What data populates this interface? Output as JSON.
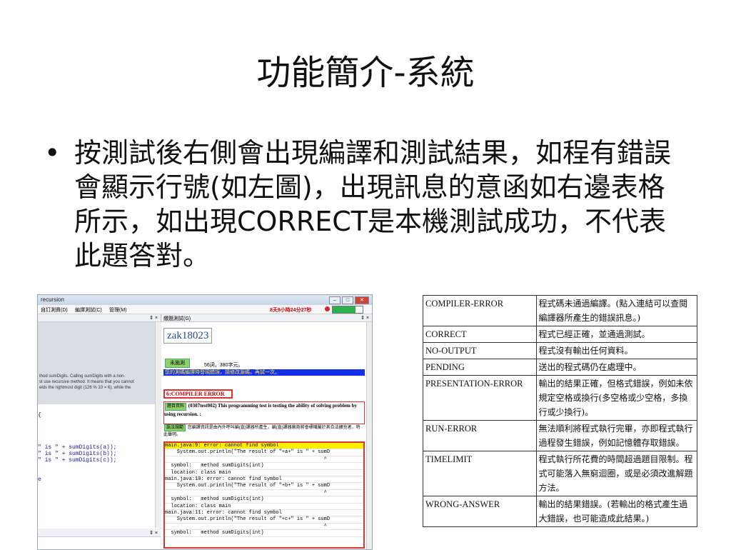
{
  "slide": {
    "title": "功能簡介-系統",
    "bullet_mark": "•",
    "bullet": "按測試後右側會出現編譯和測試結果，如程有錯誤會顯示行號(如左圖)，出現訊息的意函如右邊表格所示，如出現CORRECT是本機測試成功，不代表此題答對。"
  },
  "screenshot": {
    "window_title": "recursion",
    "menu": [
      "自訂測資(D)",
      "編譯測試(C)",
      "管理(M)"
    ],
    "timer": "8天9小時24分27秒",
    "progress": 0.75,
    "left_pane_close": "⇕ ×",
    "right_pane_header": "繳題測試(G)",
    "right_pane_close": "⇕ ×",
    "left_pane2_close": "⇕ ×",
    "desc_text": "thod sumDigits. Calling sumDigits with a non-\nst use recursive method. It means that you cannot\nelds the rightmost digit (126 % 10 = 6), while the",
    "code_lines": [
      "",
      "{",
      "",
      "",
      "",
      "",
      "\" is \" + sumDigits(a));",
      "\" is \" + sumDigits(b));",
      "\" is \" + sumDigits(c));",
      "",
      "",
      "e"
    ],
    "user_id": "zak18023",
    "untested_label": "未施測",
    "stats": "56詞，380字元。",
    "error_banner": "您的測碼編譯時發現錯誤，請修改源碼，再試一次。",
    "compile_error": "6:COMPILER ERROR",
    "problem_tag": "題目資料",
    "problem_text": "(0307test002) This programming test is testing the ability of solving problem by using recursion. :",
    "method_tag": "語法規範",
    "method_text": "您編譯資訊是由內外呼叫編(直)譯器所產生，編(直)譯器廠商將會標幟屬於其合法擴充者，特此聲明。",
    "error_log": [
      {
        "text": "main.java:9: error: cannot find symbol",
        "hl": true
      },
      {
        "text": "    System.out.println(\"The result of \"+a+\" is \" + sumD",
        "hl": false
      },
      {
        "text": "                                                     ^",
        "hl": false
      },
      {
        "text": "  symbol:   method sumDigits(int)",
        "hl": false
      },
      {
        "text": "  location: class main",
        "hl": false
      },
      {
        "text": "main.java:10: error: cannot find symbol",
        "hl": false
      },
      {
        "text": "    System.out.println(\"The result of \"+b+\" is \" + sumD",
        "hl": false
      },
      {
        "text": "                                                     ^",
        "hl": false
      },
      {
        "text": "  symbol:   method sumDigits(int)",
        "hl": false
      },
      {
        "text": "  location: class main",
        "hl": false
      },
      {
        "text": "main.java:11: error: cannot find symbol",
        "hl": false
      },
      {
        "text": "    System.out.println(\"The result of \"+c+\" is \" + sumD",
        "hl": false
      },
      {
        "text": "                                                     ^",
        "hl": false
      },
      {
        "text": "  symbol:   method sumDigits(int)",
        "hl": false
      }
    ]
  },
  "table": [
    {
      "code": "COMPILER-ERROR",
      "desc": "程式碼未通過編譯。(點入連結可以查閱編譯器所產生的錯誤訊息。)"
    },
    {
      "code": "CORRECT",
      "desc": "程式已經正確，並通過測試。"
    },
    {
      "code": "NO-OUTPUT",
      "desc": "程式沒有輸出任何資料。"
    },
    {
      "code": "PENDING",
      "desc": "送出的程式碼仍在處理中。"
    },
    {
      "code": "PRESENTATION-ERROR",
      "desc": "輸出的結果正確，但格式錯誤，例如未依規定空格或換行(多空格或少空格，多換行或少換行)。"
    },
    {
      "code": "RUN-ERROR",
      "desc": "無法順利將程式執行完畢，亦即程式執行過程發生錯誤，例如記憶體存取錯誤。"
    },
    {
      "code": "TIMELIMIT",
      "desc": "程式執行所花費的時間超過題目限制。程式可能落入無窮迴圈，或是必須改進解題方法。"
    },
    {
      "code": "WRONG-ANSWER",
      "desc": "輸出的結果錯誤。(若輸出的格式產生過大錯誤，也可能造成此結果。)"
    }
  ]
}
